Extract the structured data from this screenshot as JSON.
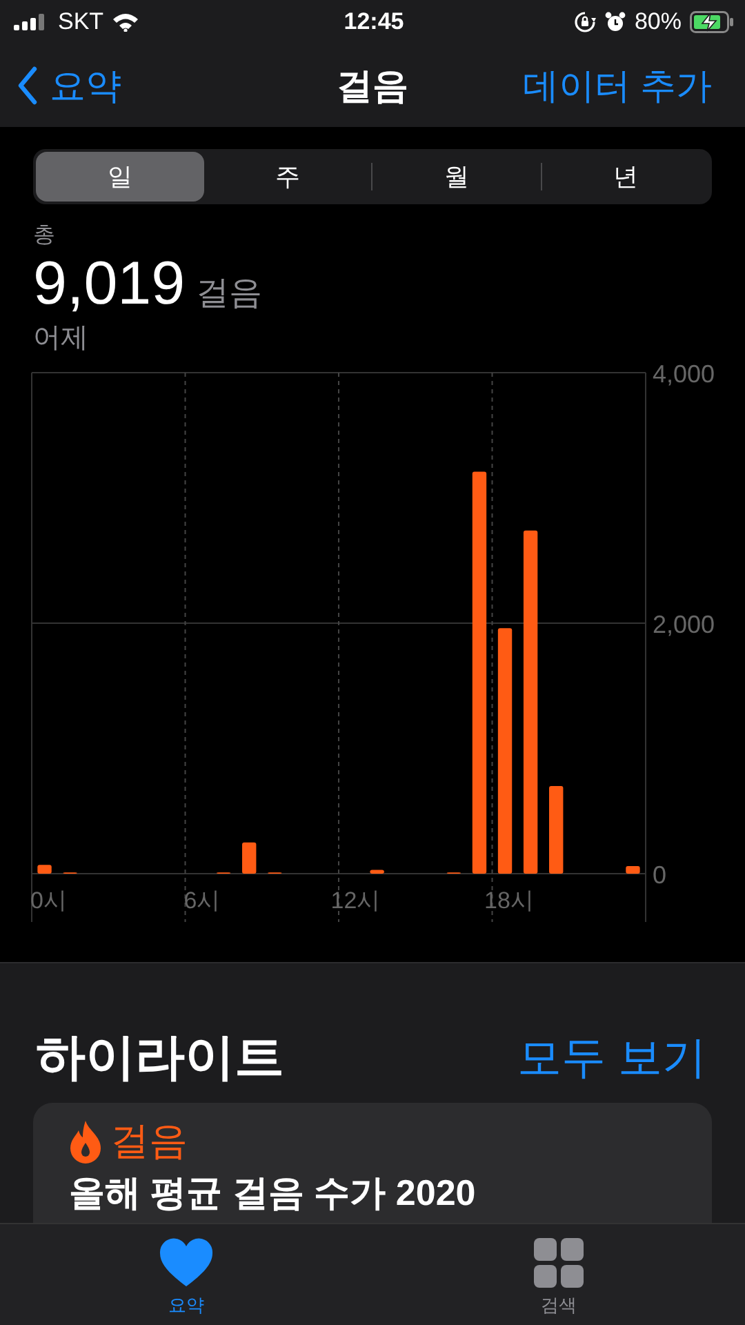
{
  "status_bar": {
    "carrier": "SKT",
    "time": "12:45",
    "battery": "80%"
  },
  "nav": {
    "back": "요약",
    "title": "걸음",
    "action": "데이터 추가"
  },
  "segments": [
    {
      "label": "일",
      "selected": true
    },
    {
      "label": "주",
      "selected": false
    },
    {
      "label": "월",
      "selected": false
    },
    {
      "label": "년",
      "selected": false
    }
  ],
  "summary": {
    "label": "총",
    "value": "9,019",
    "unit": "걸음",
    "date": "어제"
  },
  "chart": {
    "chart_data": {
      "type": "bar",
      "x": [
        0,
        1,
        7,
        8,
        9,
        13,
        16,
        17,
        18,
        19,
        20,
        23
      ],
      "values": [
        70,
        10,
        10,
        250,
        10,
        30,
        10,
        3210,
        1960,
        2740,
        700,
        60
      ],
      "xlim": [
        -0.5,
        23.5
      ],
      "ylim": [
        0,
        4000
      ],
      "xticks": [
        {
          "value": 0,
          "label": "0시"
        },
        {
          "value": 6,
          "label": "6시"
        },
        {
          "value": 12,
          "label": "12시"
        },
        {
          "value": 18,
          "label": "18시"
        }
      ],
      "yticks": [
        {
          "value": 0,
          "label": "0"
        },
        {
          "value": 2000,
          "label": "2,000"
        },
        {
          "value": 4000,
          "label": "4,000"
        }
      ]
    }
  },
  "highlights": {
    "title": "하이라이트",
    "see_all": "모두 보기",
    "card": {
      "category": "걸음",
      "text": "올해 평균 걸음 수가 2020"
    }
  },
  "tab_bar": [
    {
      "label": "요약",
      "selected": true,
      "kind": "heart"
    },
    {
      "label": "검색",
      "selected": false,
      "kind": "grid"
    }
  ]
}
